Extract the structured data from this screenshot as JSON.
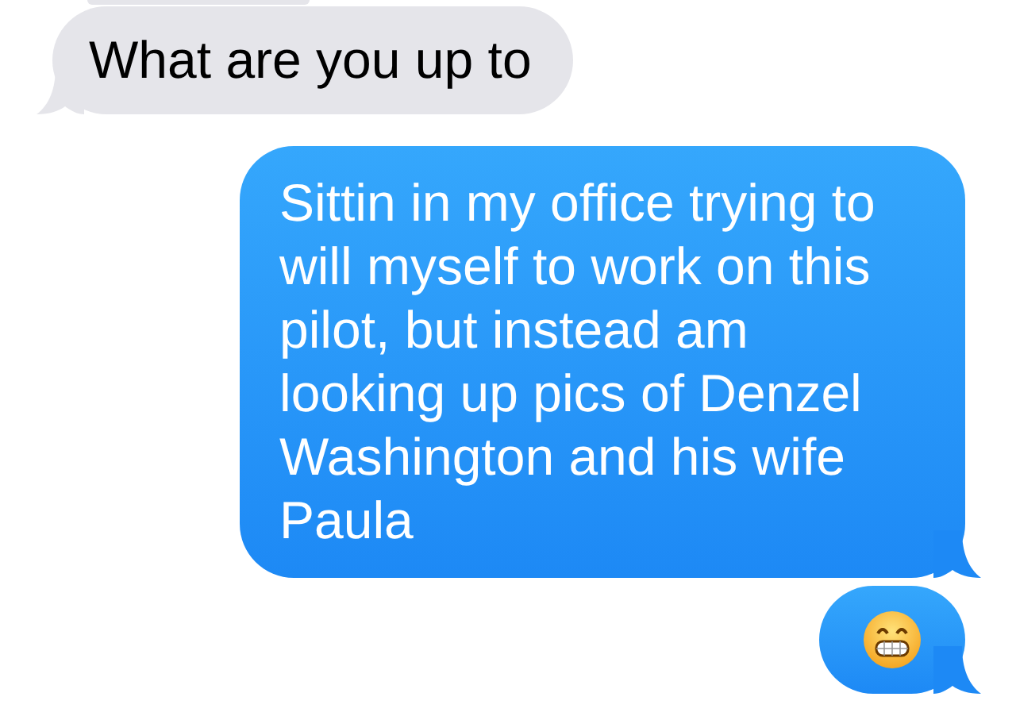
{
  "messages": [
    {
      "kind": "clipped",
      "outgoing": false
    },
    {
      "kind": "text",
      "outgoing": false,
      "text": "What are you up to"
    },
    {
      "kind": "text",
      "outgoing": true,
      "text": "Sittin in my office trying to will myself to work on this pilot, but instead am looking up pics of Denzel Washington and his wife Paula"
    },
    {
      "kind": "emoji",
      "outgoing": true
    }
  ]
}
